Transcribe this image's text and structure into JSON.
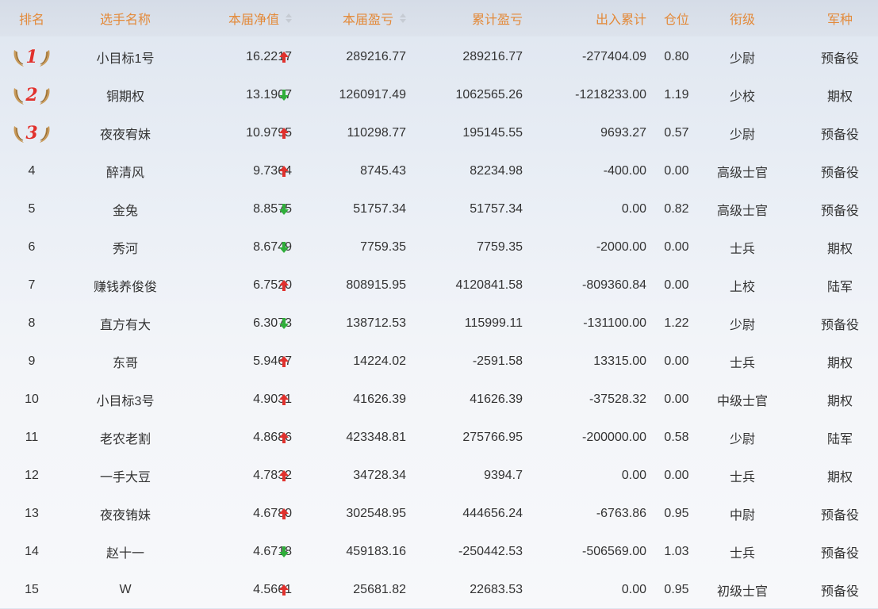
{
  "header": {
    "rank": "排名",
    "name": "选手名称",
    "nav": "本届净值",
    "pnl": "本届盈亏",
    "cumulative": "累计盈亏",
    "flow": "出入累计",
    "position": "仓位",
    "rank_title": "衔级",
    "arm": "军种"
  },
  "colors": {
    "header_text": "#e38a3a",
    "up": "#e0312d",
    "down": "#2fae3a",
    "medal_num": "#e0312d"
  },
  "rows": [
    {
      "rank": "1",
      "name": "小目标1号",
      "nav": "16.2217",
      "dir": "up",
      "pnl": "289216.77",
      "cum": "289216.77",
      "flow": "-277404.09",
      "pos": "0.80",
      "title": "少尉",
      "arm": "预备役"
    },
    {
      "rank": "2",
      "name": "铜期权",
      "nav": "13.1907",
      "dir": "down",
      "pnl": "1260917.49",
      "cum": "1062565.26",
      "flow": "-1218233.00",
      "pos": "1.19",
      "title": "少校",
      "arm": "期权"
    },
    {
      "rank": "3",
      "name": "夜夜宥妹",
      "nav": "10.9795",
      "dir": "up",
      "pnl": "110298.77",
      "cum": "195145.55",
      "flow": "9693.27",
      "pos": "0.57",
      "title": "少尉",
      "arm": "预备役"
    },
    {
      "rank": "4",
      "name": "醉清风",
      "nav": "9.7364",
      "dir": "up",
      "pnl": "8745.43",
      "cum": "82234.98",
      "flow": "-400.00",
      "pos": "0.00",
      "title": "高级士官",
      "arm": "预备役"
    },
    {
      "rank": "5",
      "name": "金兔",
      "nav": "8.8575",
      "dir": "down",
      "pnl": "51757.34",
      "cum": "51757.34",
      "flow": "0.00",
      "pos": "0.82",
      "title": "高级士官",
      "arm": "预备役"
    },
    {
      "rank": "6",
      "name": "秀河",
      "nav": "8.6749",
      "dir": "down",
      "pnl": "7759.35",
      "cum": "7759.35",
      "flow": "-2000.00",
      "pos": "0.00",
      "title": "士兵",
      "arm": "期权"
    },
    {
      "rank": "7",
      "name": "赚钱养俊俊",
      "nav": "6.7520",
      "dir": "up",
      "pnl": "808915.95",
      "cum": "4120841.58",
      "flow": "-809360.84",
      "pos": "0.00",
      "title": "上校",
      "arm": "陆军"
    },
    {
      "rank": "8",
      "name": "直方有大",
      "nav": "6.3073",
      "dir": "down",
      "pnl": "138712.53",
      "cum": "115999.11",
      "flow": "-131100.00",
      "pos": "1.22",
      "title": "少尉",
      "arm": "预备役"
    },
    {
      "rank": "9",
      "name": "东哥",
      "nav": "5.9467",
      "dir": "up",
      "pnl": "14224.02",
      "cum": "-2591.58",
      "flow": "13315.00",
      "pos": "0.00",
      "title": "士兵",
      "arm": "期权"
    },
    {
      "rank": "10",
      "name": "小目标3号",
      "nav": "4.9031",
      "dir": "up",
      "pnl": "41626.39",
      "cum": "41626.39",
      "flow": "-37528.32",
      "pos": "0.00",
      "title": "中级士官",
      "arm": "期权"
    },
    {
      "rank": "11",
      "name": "老农老割",
      "nav": "4.8686",
      "dir": "up",
      "pnl": "423348.81",
      "cum": "275766.95",
      "flow": "-200000.00",
      "pos": "0.58",
      "title": "少尉",
      "arm": "陆军"
    },
    {
      "rank": "12",
      "name": "一手大豆",
      "nav": "4.7832",
      "dir": "up",
      "pnl": "34728.34",
      "cum": "9394.7",
      "flow": "0.00",
      "pos": "0.00",
      "title": "士兵",
      "arm": "期权"
    },
    {
      "rank": "13",
      "name": "夜夜铕妹",
      "nav": "4.6780",
      "dir": "up",
      "pnl": "302548.95",
      "cum": "444656.24",
      "flow": "-6763.86",
      "pos": "0.95",
      "title": "中尉",
      "arm": "预备役"
    },
    {
      "rank": "14",
      "name": "赵十一",
      "nav": "4.6718",
      "dir": "down",
      "pnl": "459183.16",
      "cum": "-250442.53",
      "flow": "-506569.00",
      "pos": "1.03",
      "title": "士兵",
      "arm": "预备役"
    },
    {
      "rank": "15",
      "name": "W",
      "nav": "4.5661",
      "dir": "up",
      "pnl": "25681.82",
      "cum": "22683.53",
      "flow": "0.00",
      "pos": "0.95",
      "title": "初级士官",
      "arm": "预备役"
    }
  ]
}
